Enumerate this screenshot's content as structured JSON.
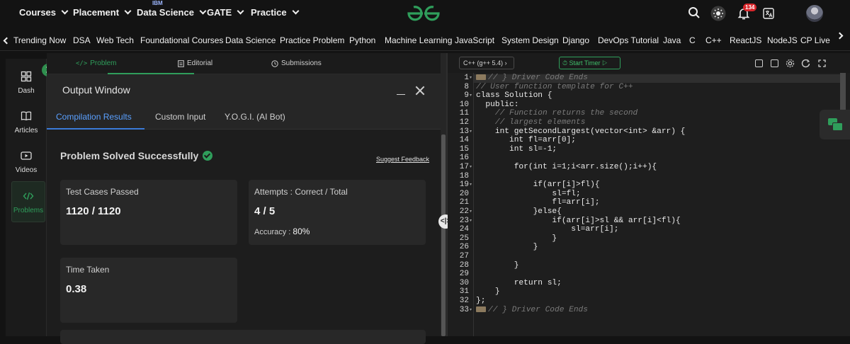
{
  "topnav": {
    "items": [
      {
        "label": "Courses"
      },
      {
        "label": "Placement"
      },
      {
        "label": "Data Science",
        "badge": "IBM"
      },
      {
        "label": "GATE"
      },
      {
        "label": "Practice"
      }
    ],
    "notification_count": "134"
  },
  "subnav": {
    "items": [
      "Trending Now",
      "DSA",
      "Web Tech",
      "Foundational Courses",
      "Data Science",
      "Practice Problem",
      "Python",
      "Machine Learning",
      "JavaScript",
      "System Design",
      "Django",
      "DevOps Tutorial",
      "Java",
      "C",
      "C++",
      "ReactJS",
      "NodeJS",
      "CP Live"
    ]
  },
  "sidebar": {
    "items": [
      {
        "label": "Dash",
        "icon": "dashboard-icon"
      },
      {
        "label": "Articles",
        "icon": "book-icon"
      },
      {
        "label": "Videos",
        "icon": "video-icon"
      },
      {
        "label": "Problems",
        "icon": "code-icon",
        "active": true
      }
    ]
  },
  "problem_tabs": {
    "problem": "Problem",
    "editorial": "Editorial",
    "submissions": "Submissions"
  },
  "output": {
    "title": "Output Window",
    "tabs": [
      "Compilation Results",
      "Custom Input",
      "Y.O.G.I. (AI Bot)"
    ],
    "status": "Problem Solved Successfully",
    "feedback": "Suggest Feedback",
    "tests_label": "Test Cases Passed",
    "tests_value": "1120 / 1120",
    "attempts_label": "Attempts : Correct / Total",
    "attempts_value": "4 / 5",
    "accuracy_label": "Accuracy :",
    "accuracy_value": "80%",
    "time_label": "Time Taken",
    "time_value": "0.38"
  },
  "editor": {
    "language": "C++ (g++ 5.4)",
    "timer": "Start Timer",
    "lines": [
      {
        "n": "1",
        "text": "// } Driver Code Ends",
        "comment": true,
        "collapsed": true
      },
      {
        "n": "8",
        "text": "// User function template for C++",
        "comment": true
      },
      {
        "n": "9",
        "text": "class Solution {"
      },
      {
        "n": "10",
        "text": "  public:"
      },
      {
        "n": "11",
        "text": "    // Function returns the second",
        "comment": true
      },
      {
        "n": "12",
        "text": "    // largest elements",
        "comment": true
      },
      {
        "n": "13",
        "text": "    int getSecondLargest(vector<int> &arr) {"
      },
      {
        "n": "14",
        "text": "       int fl=arr[0];"
      },
      {
        "n": "15",
        "text": "       int sl=-1;"
      },
      {
        "n": "16",
        "text": ""
      },
      {
        "n": "17",
        "text": "        for(int i=1;i<arr.size();i++){"
      },
      {
        "n": "18",
        "text": ""
      },
      {
        "n": "19",
        "text": "            if(arr[i]>fl){"
      },
      {
        "n": "20",
        "text": "                sl=fl;"
      },
      {
        "n": "21",
        "text": "                fl=arr[i];"
      },
      {
        "n": "22",
        "text": "            }else{"
      },
      {
        "n": "23",
        "text": "                if(arr[i]>sl && arr[i]<fl){"
      },
      {
        "n": "24",
        "text": "                    sl=arr[i];"
      },
      {
        "n": "25",
        "text": "                }"
      },
      {
        "n": "26",
        "text": "            }"
      },
      {
        "n": "27",
        "text": ""
      },
      {
        "n": "28",
        "text": "        }"
      },
      {
        "n": "29",
        "text": ""
      },
      {
        "n": "30",
        "text": "        return sl;"
      },
      {
        "n": "31",
        "text": "    }"
      },
      {
        "n": "32",
        "text": "};"
      },
      {
        "n": "33",
        "text": "// } Driver Code Ends",
        "comment": true,
        "collapsed": true
      }
    ]
  },
  "colors": {
    "accent": "#2f9e5b",
    "tab_blue": "#5aa0ff",
    "bg": "#131313"
  }
}
